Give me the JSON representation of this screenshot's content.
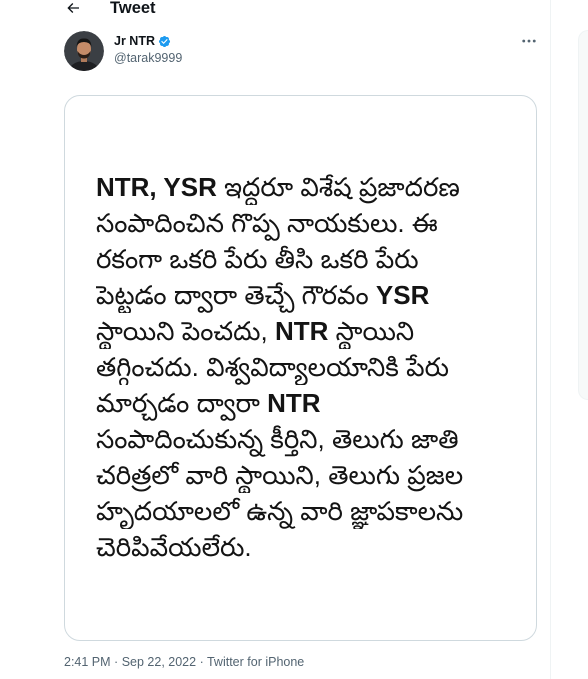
{
  "header": {
    "back_icon": "arrow-left-icon",
    "title": "Tweet"
  },
  "author": {
    "name": "Jr NTR",
    "verified_icon": "verified-badge-icon",
    "handle": "@tarak9999"
  },
  "more_icon": "more-options-icon",
  "tweet_image": {
    "lines": [
      [
        "NTR, YSR",
        "ఇద్దరూ విశేష ప్రజాదరణ"
      ],
      [
        "సంపాదించిన గొప్ప నాయకులు. ఈ"
      ],
      [
        "రకంగా ఒకరి పేరు తీసి ఒకరి పేరు"
      ],
      [
        "పెట్టడం ద్వారా తెచ్చే గౌరవం",
        "YSR"
      ],
      [
        "స్థాయిని పెంచదు,",
        "NTR",
        "స్థాయిని"
      ],
      [
        "తగ్గించదు. విశ్వవిద్యాలయానికి పేరు"
      ],
      [
        "మార్చడం ద్వారా",
        "NTR"
      ],
      [
        "సంపాదించుకున్న కీర్తిని, తెలుగు జాతి"
      ],
      [
        "చరిత్రలో వారి స్థాయిని, తెలుగు ప్రజల"
      ],
      [
        "హృదయాలలో ఉన్న వారి జ్ఞాపకాలను"
      ],
      [
        "చెరిపివేయలేరు."
      ]
    ]
  },
  "meta": {
    "time": "2:41 PM",
    "separator": "·",
    "date": "Sep 22, 2022",
    "source": "Twitter for iPhone"
  },
  "colors": {
    "text": "#0f1419",
    "secondary": "#536471",
    "verified": "#1d9bf0",
    "border": "#cfd9de",
    "divider": "#eff3f4"
  }
}
